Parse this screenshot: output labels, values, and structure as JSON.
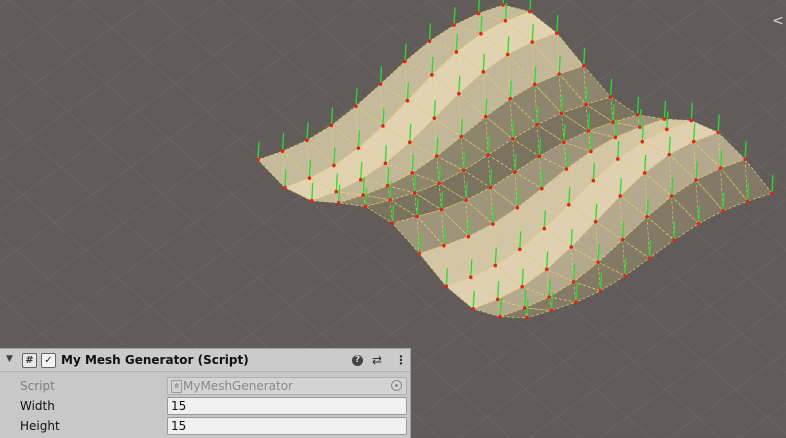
{
  "component": {
    "title": "My Mesh Generator (Script)",
    "script_icon": "#",
    "enabled_check": "✓",
    "help_icon": "?",
    "presets_icon": "⇄",
    "more_icon": "⋮",
    "foldout_icon": "▼"
  },
  "fields": {
    "script": {
      "label": "Script",
      "value": "MyMeshGenerator",
      "icon": "#"
    },
    "width": {
      "label": "Width",
      "value": "15"
    },
    "height": {
      "label": "Height",
      "value": "15"
    }
  },
  "scene": {
    "gizmo_arrow": "<",
    "mesh_color": "#b9ad94",
    "wire_color": "#e8d060",
    "vertex_color": "#e8201a",
    "normal_color": "#1fe22a",
    "background": "#615c59"
  }
}
